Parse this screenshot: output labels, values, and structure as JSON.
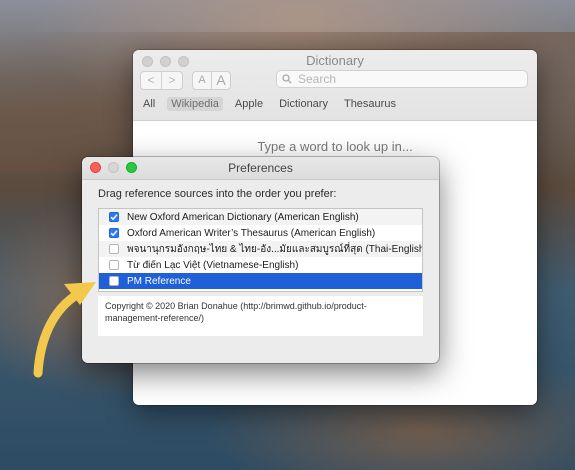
{
  "dictionary_window": {
    "title": "Dictionary",
    "nav": {
      "back": "<",
      "forward": ">"
    },
    "font_buttons": {
      "smaller": "A",
      "larger": "A"
    },
    "search": {
      "placeholder": "Search",
      "value": ""
    },
    "source_tabs": [
      {
        "label": "All",
        "active": false
      },
      {
        "label": "Wikipedia",
        "active": true
      },
      {
        "label": "Apple",
        "active": false
      },
      {
        "label": "Dictionary",
        "active": false
      },
      {
        "label": "Thesaurus",
        "active": false
      }
    ],
    "placeholder_text": "Type a word to look up in..."
  },
  "preferences_window": {
    "title": "Preferences",
    "instructions": "Drag reference sources into the order you prefer:",
    "sources": [
      {
        "label": "New Oxford American Dictionary (American English)",
        "checked": true,
        "selected": false
      },
      {
        "label": "Oxford American Writer’s Thesaurus (American English)",
        "checked": true,
        "selected": false
      },
      {
        "label": "พจนานุกรมอังกฤษ-ไทย & ไทย-อัง...มัยและสมบูรณ์ที่สุด (Thai-English)",
        "checked": false,
        "selected": false
      },
      {
        "label": "Từ điển Lạc Việt (Vietnamese-English)",
        "checked": false,
        "selected": false
      },
      {
        "label": "PM Reference",
        "checked": false,
        "selected": true
      }
    ],
    "copyright": "Copyright © 2020 Brian Donahue (http://brimwd.github.io/product-management-reference/)"
  },
  "colors": {
    "selection": "#1f5fd8",
    "checkbox_checked": "#2a7af2",
    "arrow": "#f2c94c"
  },
  "icons": [
    "search-icon",
    "checkmark-icon",
    "arrow-annotation"
  ]
}
